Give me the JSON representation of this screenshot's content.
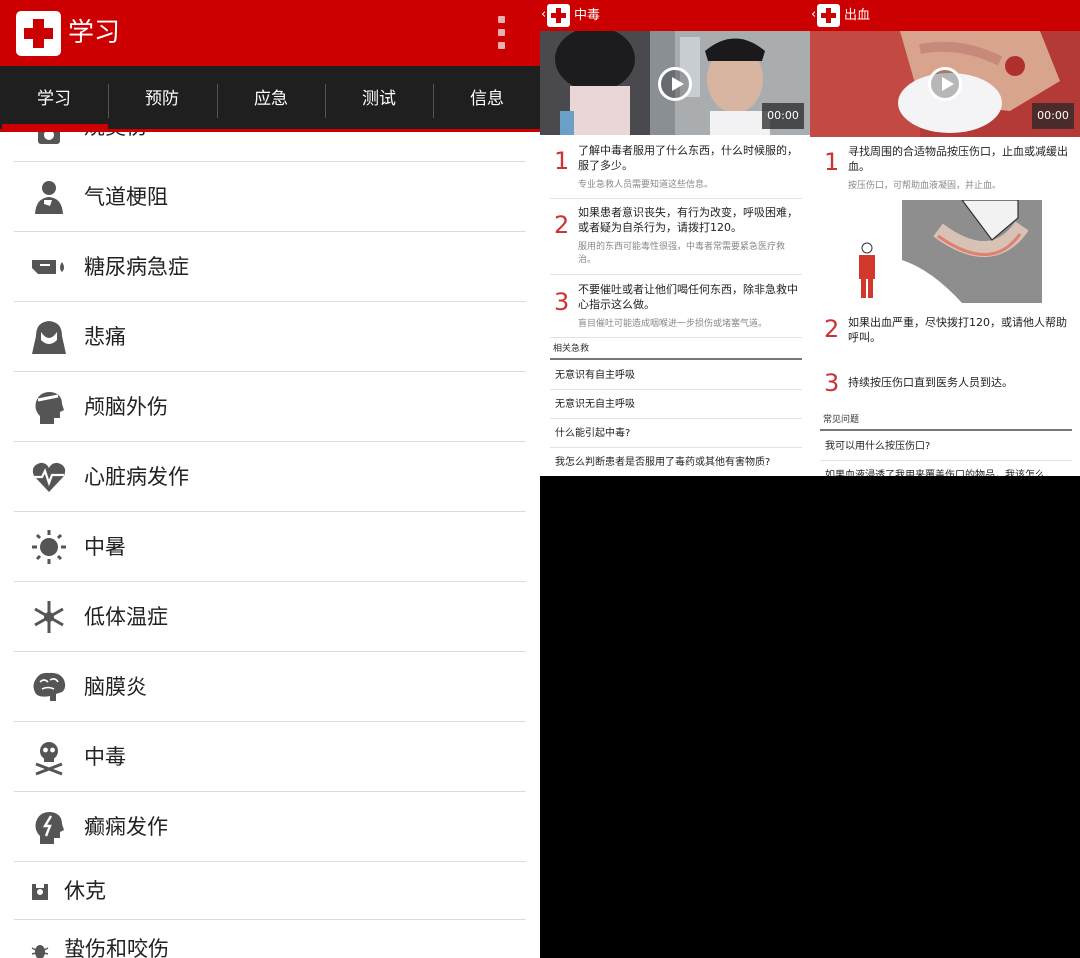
{
  "app": {
    "title": "学习"
  },
  "tabs": [
    {
      "label": "学习"
    },
    {
      "label": "预防"
    },
    {
      "label": "应急"
    },
    {
      "label": "测试"
    },
    {
      "label": "信息"
    }
  ],
  "list": [
    {
      "label": "烧烫伤",
      "icon": "burn-icon"
    },
    {
      "label": "气道梗阻",
      "icon": "choking-icon"
    },
    {
      "label": "糖尿病急症",
      "icon": "diabetes-icon"
    },
    {
      "label": "悲痛",
      "icon": "grief-icon"
    },
    {
      "label": "颅脑外伤",
      "icon": "head-injury-icon"
    },
    {
      "label": "心脏病发作",
      "icon": "heart-attack-icon"
    },
    {
      "label": "中暑",
      "icon": "sun-icon"
    },
    {
      "label": "低体温症",
      "icon": "snowflake-icon"
    },
    {
      "label": "脑膜炎",
      "icon": "brain-icon"
    },
    {
      "label": "中毒",
      "icon": "skull-crossbones-icon"
    },
    {
      "label": "癫痫发作",
      "icon": "seizure-icon"
    },
    {
      "label": "休克",
      "icon": "shock-icon"
    },
    {
      "label": "蛰伤和咬伤",
      "icon": "bug-icon"
    }
  ],
  "poison": {
    "back": "‹",
    "title": "中毒",
    "video_time": "00:00",
    "steps": [
      {
        "num": "1",
        "text": "了解中毒者服用了什么东西，什么时候服的，服了多少。",
        "sub": "专业急救人员需要知道这些信息。"
      },
      {
        "num": "2",
        "text": "如果患者意识丧失，有行为改变，呼吸困难，或者疑为自杀行为，请拨打120。",
        "sub": "服用的东西可能毒性很强，中毒者常需要紧急医疗救治。"
      },
      {
        "num": "3",
        "text": "不要催吐或者让他们喝任何东西，除非急救中心指示这么做。",
        "sub": "盲目催吐可能造成咽喉进一步损伤或堵塞气道。"
      }
    ],
    "related_header": "相关急救",
    "related": [
      "无意识有自主呼吸",
      "无意识无自主呼吸",
      "什么能引起中毒?",
      "我怎么判断患者是否服用了毒药或其他有害物质?"
    ]
  },
  "bleeding": {
    "back": "‹",
    "title": "出血",
    "video_time": "00:00",
    "steps": [
      {
        "num": "1",
        "text": "寻找周围的合适物品按压伤口，止血或减缓出血。",
        "sub": "按压伤口，可帮助血液凝固，并止血。"
      },
      {
        "num": "2",
        "text": "如果出血严重，尽快拨打120，或请他人帮助呼叫。"
      },
      {
        "num": "3",
        "text": "持续按压伤口直到医务人员到达。"
      }
    ],
    "faq_header": "常见问题",
    "faq": [
      "我可以用什么按压伤口?",
      "如果血液浸透了我用来覆盖伤口的物品，我该怎么"
    ]
  },
  "colors": {
    "brand_red": "#cc0000",
    "tab_bg": "#1f1f1f",
    "icon_gray": "#555555",
    "number_red": "#cc3333"
  }
}
